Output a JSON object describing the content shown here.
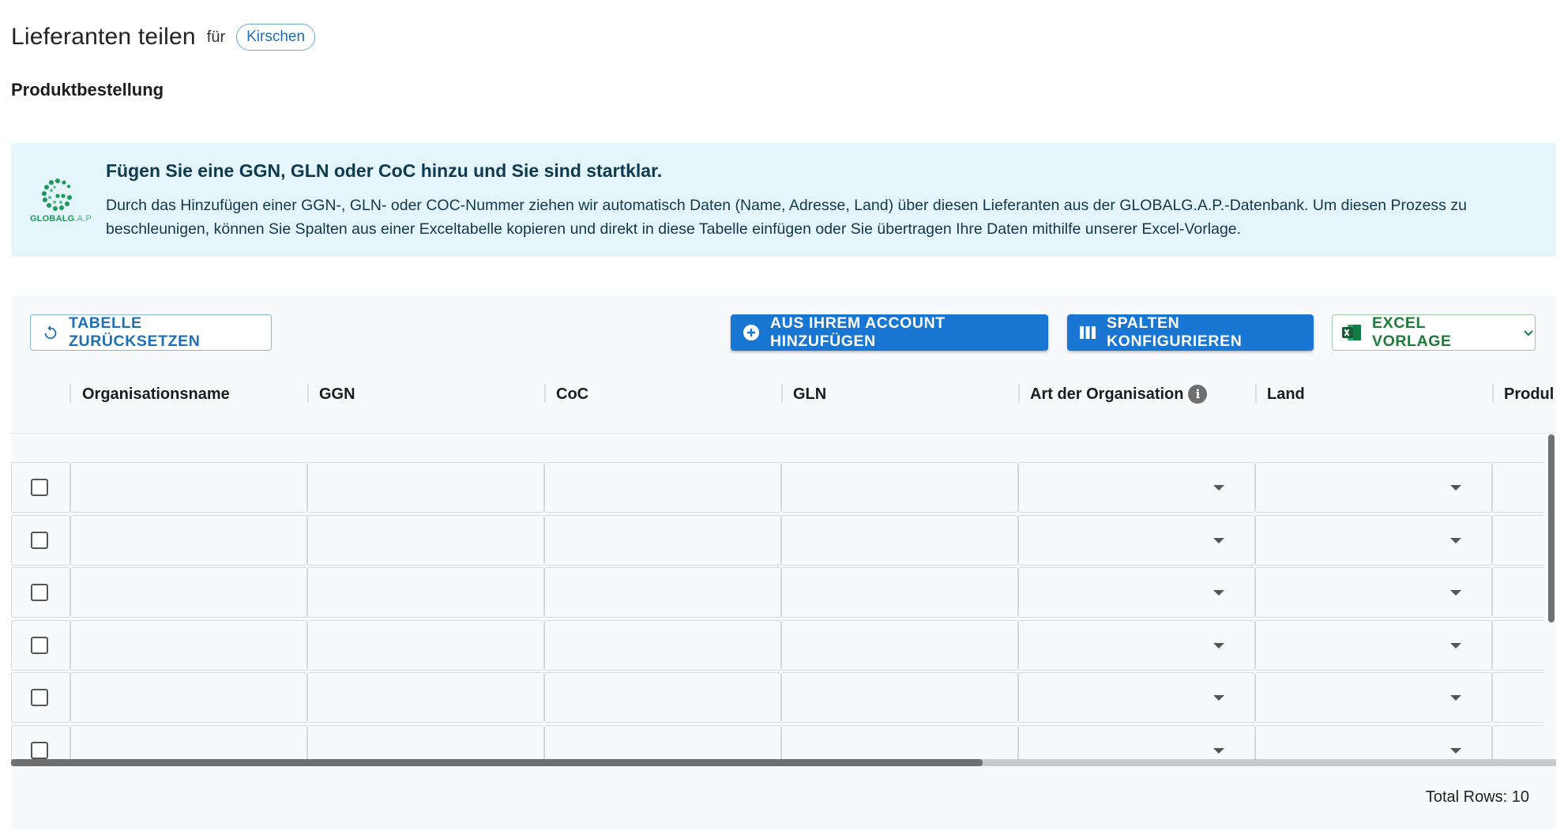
{
  "header": {
    "title": "Lieferanten teilen",
    "for_label": "für",
    "product_chip": "Kirschen"
  },
  "section": {
    "title": "Produktbestellung"
  },
  "info_banner": {
    "logo_text_bold": "GLOBALG",
    "logo_text_light": ".A.P",
    "title": "Fügen Sie eine GGN, GLN oder CoC hinzu und Sie sind startklar.",
    "text": "Durch das Hinzufügen einer GGN-, GLN- oder COC-Nummer ziehen wir automatisch Daten (Name, Adresse, Land) über diesen Lieferanten aus der GLOBALG.A.P.-Datenbank. Um diesen Prozess zu beschleunigen, können Sie Spalten aus einer Exceltabelle kopieren und direkt in diese Tabelle einfügen oder Sie übertragen Ihre Daten mithilfe unserer Excel-Vorlage."
  },
  "toolbar": {
    "reset_label": "TABELLE ZURÜCKSETZEN",
    "add_from_account_label": "AUS IHREM ACCOUNT HINZUFÜGEN",
    "configure_columns_label": "SPALTEN KONFIGURIEREN",
    "excel_template_label": "EXCEL VORLAGE"
  },
  "columns": [
    "Organisationsname",
    "GGN",
    "CoC",
    "GLN",
    "Art der Organisation",
    "Land",
    "Produl"
  ],
  "rows": [
    {
      "checked": false,
      "values": [
        "",
        "",
        "",
        "",
        "",
        "",
        ""
      ]
    },
    {
      "checked": false,
      "values": [
        "",
        "",
        "",
        "",
        "",
        "",
        ""
      ]
    },
    {
      "checked": false,
      "values": [
        "",
        "",
        "",
        "",
        "",
        "",
        ""
      ]
    },
    {
      "checked": false,
      "values": [
        "",
        "",
        "",
        "",
        "",
        "",
        ""
      ]
    },
    {
      "checked": false,
      "values": [
        "",
        "",
        "",
        "",
        "",
        "",
        ""
      ]
    },
    {
      "checked": false,
      "values": [
        "",
        "",
        "",
        "",
        "",
        "",
        ""
      ]
    }
  ],
  "footer": {
    "total_rows": "Total Rows: 10"
  },
  "colors": {
    "primary": "#1976d2",
    "banner_bg": "#e4f5fc",
    "excel_green": "#1e7a3a",
    "logo_green": "#1b9a57"
  },
  "icons": {
    "reset": "refresh-icon",
    "add": "add-circle-icon",
    "columns": "view-column-icon",
    "excel": "excel-icon",
    "dropdown": "chevron-down-icon",
    "info": "info-icon"
  }
}
